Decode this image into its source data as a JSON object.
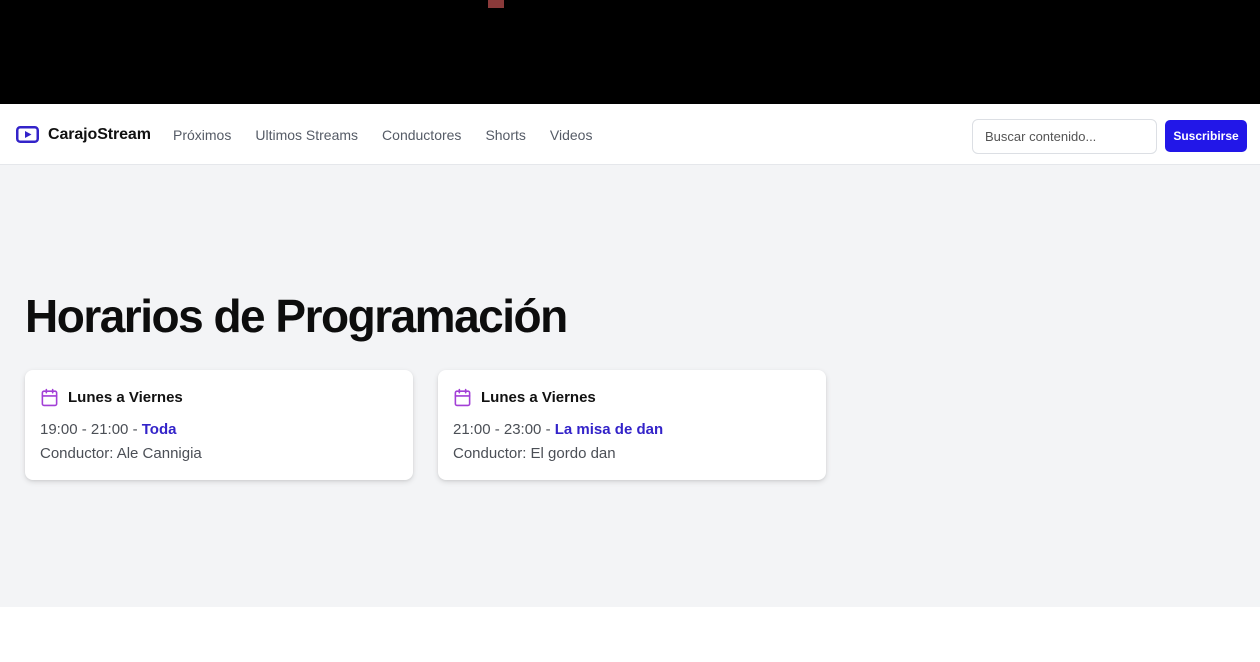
{
  "brand": {
    "name": "CarajoStream",
    "icon": "play-video-icon",
    "accent": "#3323c9"
  },
  "nav": {
    "links": [
      "Próximos",
      "Ultimos Streams",
      "Conductores",
      "Shorts",
      "Videos"
    ]
  },
  "search": {
    "placeholder": "Buscar contenido...",
    "value": ""
  },
  "subscribe": {
    "label": "Suscribirse",
    "color": "#2217e8"
  },
  "page": {
    "title": "Horarios de Programación"
  },
  "schedule": [
    {
      "day": "Lunes a Viernes",
      "time": "19:00 - 21:00",
      "separator": " - ",
      "show": "Toda",
      "host": "Conductor: Ale Cannigia",
      "icon": "calendar-icon"
    },
    {
      "day": "Lunes a Viernes",
      "time": "21:00 - 23:00",
      "separator": " - ",
      "show": "La misa de dan",
      "host": "Conductor: El gordo dan",
      "icon": "calendar-icon"
    }
  ],
  "colors": {
    "icon_purple": "#a23fd6",
    "background": "#f3f4f6"
  }
}
